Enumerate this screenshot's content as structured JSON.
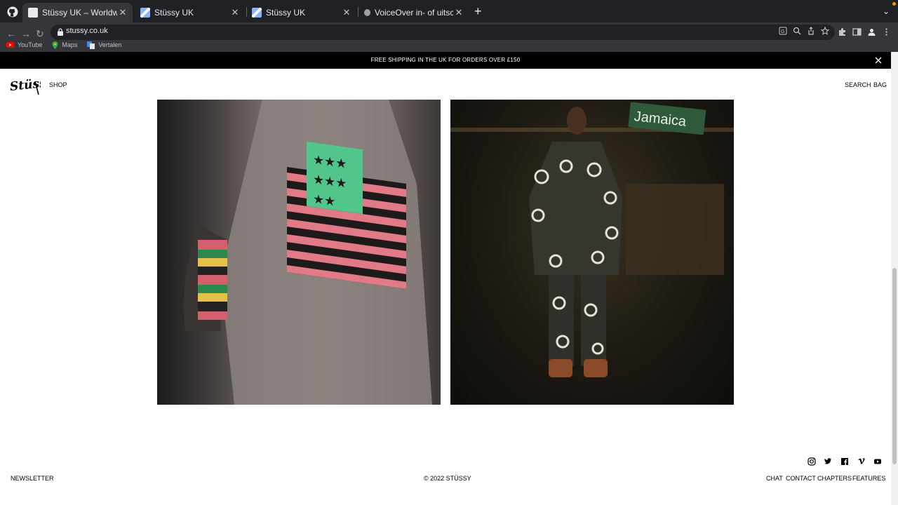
{
  "browser": {
    "tabs": [
      {
        "title": "Stüssy UK – Worldwide Since",
        "active": true
      },
      {
        "title": "Stüssy UK",
        "active": false
      },
      {
        "title": "Stüssy UK",
        "active": false
      },
      {
        "title": "VoiceOver in- of uitschakelen o",
        "active": false
      }
    ],
    "url": "stussy.co.uk",
    "bookmarks": [
      {
        "label": "YouTube",
        "icon": "youtube-icon"
      },
      {
        "label": "Maps",
        "icon": "maps-icon"
      },
      {
        "label": "Vertalen",
        "icon": "translate-icon"
      }
    ]
  },
  "banner": {
    "text": "FREE SHIPPING IN THE UK FOR ORDERS OVER £150"
  },
  "header": {
    "logo": "Stüssy",
    "shop": "SHOP",
    "search": "SEARCH",
    "bag": "BAG"
  },
  "images": [
    {
      "description": "knit-sweater-flag-closeup"
    },
    {
      "description": "model-printed-denim-jamaica-ave"
    }
  ],
  "footer": {
    "newsletter": "NEWSLETTER",
    "copyright": "© 2022 STÜSSY",
    "links": [
      "CHAT",
      "CONTACT",
      "CHAPTERS",
      "FEATURES"
    ],
    "social": [
      "instagram-icon",
      "twitter-icon",
      "facebook-icon",
      "vimeo-icon",
      "youtube-icon"
    ]
  },
  "street_sign": "Jamaica"
}
